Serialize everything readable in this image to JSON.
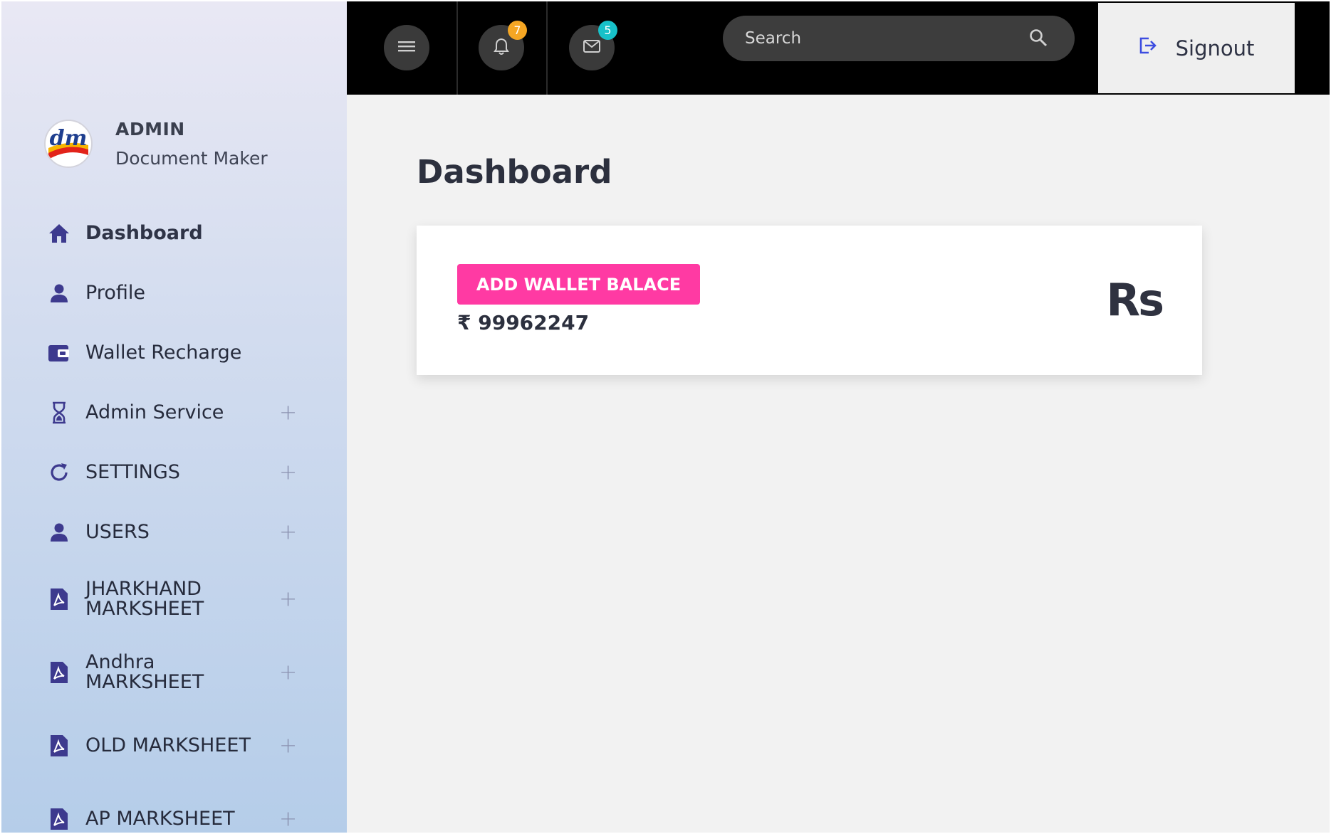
{
  "brand": {
    "title": "ADMIN",
    "subtitle": "Document Maker",
    "logo_text": "dm"
  },
  "sidebar": {
    "items": [
      {
        "label": "Dashboard",
        "icon": "home-icon",
        "expandable": false
      },
      {
        "label": "Profile",
        "icon": "user-icon",
        "expandable": false
      },
      {
        "label": "Wallet Recharge",
        "icon": "wallet-icon",
        "expandable": false
      },
      {
        "label": "Admin Service",
        "icon": "hourglass-icon",
        "expandable": true
      },
      {
        "label": "SETTINGS",
        "icon": "refresh-icon",
        "expandable": true
      },
      {
        "label": "USERS",
        "icon": "user-icon",
        "expandable": true
      },
      {
        "label": "JHARKHAND MARKSHEET",
        "icon": "pdf-icon",
        "expandable": true
      },
      {
        "label": "Andhra MARKSHEET",
        "icon": "pdf-icon",
        "expandable": true
      },
      {
        "label": "OLD MARKSHEET",
        "icon": "pdf-icon",
        "expandable": true
      },
      {
        "label": "AP MARKSHEET",
        "icon": "pdf-icon",
        "expandable": true
      }
    ],
    "expand_symbol": "+"
  },
  "topbar": {
    "notifications_count": "7",
    "messages_count": "5",
    "search_placeholder": "Search",
    "signout_label": "Signout",
    "colors": {
      "notification_badge": "#f5a623",
      "message_badge": "#17c1c9"
    }
  },
  "main": {
    "title": "Dashboard",
    "wallet_button_label": "ADD WALLET BALACE",
    "balance": "₹ 99962247",
    "currency_icon": "Rs"
  },
  "colors": {
    "accent": "#ff3aa3",
    "nav_icon": "#3d3a8e"
  }
}
